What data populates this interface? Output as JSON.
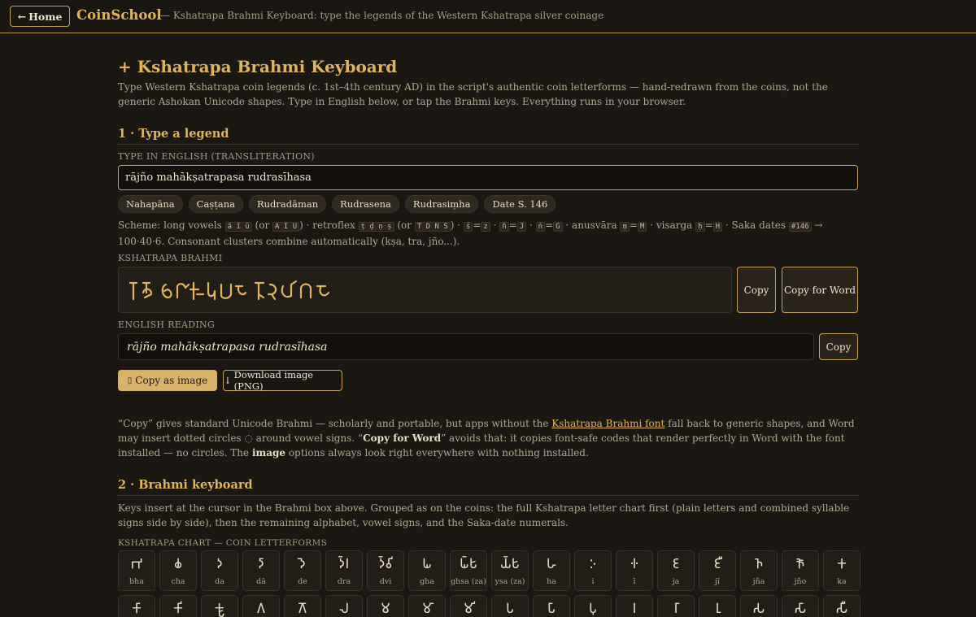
{
  "topbar": {
    "home_label": "Home",
    "brand": "CoinSchool",
    "tagline": "— Kshatrapa Brahmi Keyboard: type the legends of the Western Kshatrapa silver coinage"
  },
  "page": {
    "title": "+ Kshatrapa Brahmi Keyboard",
    "intro": "Type Western Kshatrapa coin legends (c. 1st–4th century AD) in the script's authentic coin letterforms — hand-redrawn from the coins, not the generic Ashokan Unicode shapes. Type in English below, or tap the Brahmi keys. Everything runs in your browser."
  },
  "section1": {
    "heading": "1 · Type a legend",
    "input_label": "Type in English (transliteration)",
    "input_value": "rājño mahākṣatrapasa rudrasīhasa",
    "chips": [
      "Nahapāna",
      "Caṣṭana",
      "Rudradāman",
      "Rudrasena",
      "Rudrasiṃha",
      "Date S. 146"
    ],
    "scheme": {
      "t1": "Scheme: long vowels",
      "c1": "ā ī ū",
      "t2": "(or",
      "c2": "A I U",
      "t3": ") · retroflex",
      "c3": "ṭ ḍ ṇ ṣ",
      "t4": "(or",
      "c4": "T D N S",
      "t5": ") ·",
      "c5": "ś",
      "t6": "=",
      "c6": "z",
      "t7": "·",
      "c7": "ñ",
      "t8": "=",
      "c8": "J",
      "t9": "·",
      "c9": "ṅ",
      "t10": "=",
      "c10": "G",
      "t11": "· anusvāra",
      "c11": "ṃ",
      "t12": "=",
      "c12": "M",
      "t13": "· visarga",
      "c13": "ḥ",
      "t14": "=",
      "c14": "H",
      "t15": "· Saka dates",
      "c15": "#146",
      "t16": "→ 100·40·6. Consonant clusters combine automatically (kṣa, tra, jño...)."
    },
    "brahmi_label": "Kshatrapa Brahmi",
    "brahmi_text": "𑀭𑀸𑀜𑁄 𑀫𑀳𑀓𑁆𑀱𑀢𑁆𑀭𑀧𑀲 𑀭𑀼𑀤𑁆𑀭𑀲𑀻𑀳𑀲",
    "copy_label": "Copy",
    "copy_word_label": "Copy for Word",
    "reading_label": "English reading",
    "reading_value": "rājño mahākṣatrapasa rudrasīhasa",
    "reading_copy_label": "Copy",
    "copy_image_label": "Copy as image",
    "copy_image_icon": "clipboard-icon",
    "download_label": "Download image (PNG)",
    "download_icon": "↓",
    "note": {
      "p1": "“Copy” gives standard Unicode Brahmi — scholarly and portable, but apps without the ",
      "link": "Kshatrapa Brahmi font",
      "p2": " fall back to generic shapes, and Word may insert dotted circles ◌ around vowel signs. “",
      "b1": "Copy for Word",
      "p3": "” avoids that: it copies font-safe codes that render perfectly in Word with the font installed — no circles. The ",
      "b2": "image",
      "p4": " options always look right everywhere with nothing installed."
    }
  },
  "section2": {
    "heading": "2 · Brahmi keyboard",
    "desc": "Keys insert at the cursor in the Brahmi box above. Grouped as on the coins: the full Kshatrapa letter chart first (plain letters and combined syllable signs side by side), then the remaining alphabet, vowel signs, and the Saka-date numerals.",
    "chart_label": "Kshatrapa chart — coin letterforms",
    "row1": [
      {
        "g": "𑀪",
        "t": "bha"
      },
      {
        "g": "𑀙",
        "t": "cha"
      },
      {
        "g": "𑀤",
        "t": "da"
      },
      {
        "g": "𑀤𑀸",
        "t": "dā"
      },
      {
        "g": "𑀤𑁂",
        "t": "de"
      },
      {
        "g": "𑀤𑁆𑀭",
        "t": "dra"
      },
      {
        "g": "𑀤𑁆𑀯𑀺",
        "t": "dvi"
      },
      {
        "g": "𑀖",
        "t": "gha"
      },
      {
        "g": "𑀖𑁆𑀱",
        "t": "ghsa (za)"
      },
      {
        "g": "𑀬𑁆𑀱",
        "t": "ysa (za)"
      },
      {
        "g": "𑀳",
        "t": "ha"
      },
      {
        "g": "𑀇",
        "t": "i"
      },
      {
        "g": "𑀈",
        "t": "ī"
      },
      {
        "g": "𑀚",
        "t": "ja"
      },
      {
        "g": "𑀚𑀻",
        "t": "jī"
      },
      {
        "g": "𑀜",
        "t": "jña"
      },
      {
        "g": "𑀜𑁄",
        "t": "jño"
      },
      {
        "g": "𑀓",
        "t": "ka"
      }
    ],
    "row2": [
      {
        "g": "𑀓𑀸",
        "t": ""
      },
      {
        "g": "𑀓𑀺",
        "t": ""
      },
      {
        "g": "𑀓𑁆𑀱",
        "t": ""
      },
      {
        "g": "𑀕",
        "t": ""
      },
      {
        "g": "𑀕𑁄",
        "t": ""
      },
      {
        "g": "𑀮",
        "t": ""
      },
      {
        "g": "𑀫",
        "t": ""
      },
      {
        "g": "𑀫𑀸",
        "t": ""
      },
      {
        "g": "𑀫𑀺",
        "t": ""
      },
      {
        "g": "𑀧",
        "t": ""
      },
      {
        "g": "𑀧𑀸",
        "t": ""
      },
      {
        "g": "𑀧𑀼",
        "t": ""
      },
      {
        "g": "𑀭",
        "t": ""
      },
      {
        "g": "𑀭𑀸",
        "t": ""
      },
      {
        "g": "𑀭𑀼",
        "t": ""
      },
      {
        "g": "𑀲",
        "t": ""
      },
      {
        "g": "𑀲𑀸",
        "t": ""
      },
      {
        "g": "𑀲𑀻",
        "t": ""
      }
    ]
  },
  "colors": {
    "accent": "#e2b35d",
    "background": "#1b1713",
    "panel": "#221d17",
    "border": "#3a3128"
  }
}
